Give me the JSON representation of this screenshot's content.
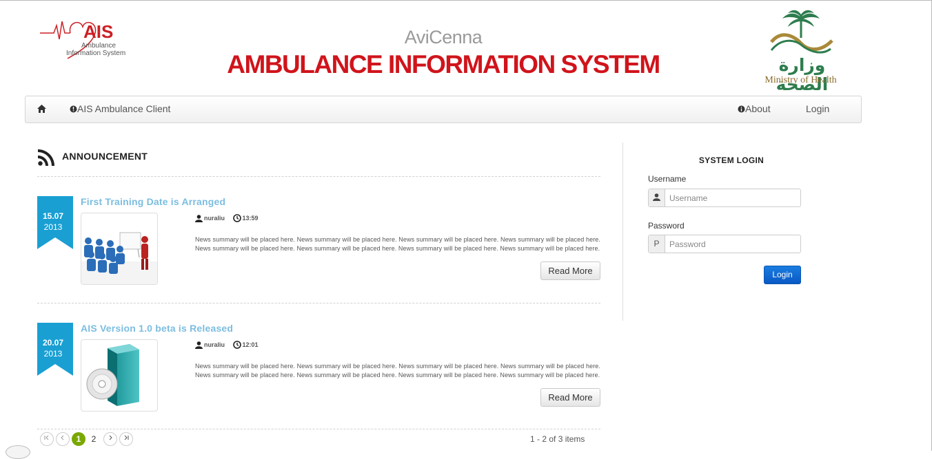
{
  "header": {
    "ais_logo_text": "AIS",
    "ais_logo_sub1": "Ambulance",
    "ais_logo_sub2": "Information System",
    "avicenna": "AviCenna",
    "title": "AMBULANCE INFORMATION SYSTEM",
    "moh_arabic": "وزارة الصحة",
    "moh_english": "Ministry of Health"
  },
  "nav": {
    "home_icon": "home-icon",
    "client_label": "AIS Ambulance Client",
    "about_label": "About",
    "login_label": "Login"
  },
  "announcement": {
    "heading": "ANNOUNCEMENT",
    "items": [
      {
        "day": "15.07",
        "year": "2013",
        "title": "First Training Date is Arranged",
        "author": "nuraliu",
        "time": "13:59",
        "summary": "News summary will be placed here. News summary will be placed here. News summary will be placed here. News summary will be placed here. News summary will be placed here. News summary will be placed here. News summary will be placed here. News summary will be placed here.",
        "read_more": "Read More",
        "image": "training-presentation-image"
      },
      {
        "day": "20.07",
        "year": "2013",
        "title": "AIS Version 1.0 beta is Released",
        "author": "nuraliu",
        "time": "12:01",
        "summary": "News summary will be placed here. News summary will be placed here. News summary will be placed here. News summary will be placed here. News summary will be placed here. News summary will be placed here. News summary will be placed here. News summary will be placed here.",
        "read_more": "Read More",
        "image": "software-box-image"
      }
    ]
  },
  "pager": {
    "pages": [
      "1",
      "2"
    ],
    "current": "1",
    "info": "1 - 2 of 3 items"
  },
  "login": {
    "title": "SYSTEM LOGIN",
    "username_label": "Username",
    "username_placeholder": "Username",
    "password_label": "Password",
    "password_placeholder": "Password",
    "password_addon": "P",
    "button": "Login"
  },
  "colors": {
    "brand_red": "#d0141b",
    "link_blue": "#7bbde0",
    "ribbon_blue": "#1a9fd3",
    "login_blue": "#0a59c5",
    "pager_green": "#7aa800"
  }
}
